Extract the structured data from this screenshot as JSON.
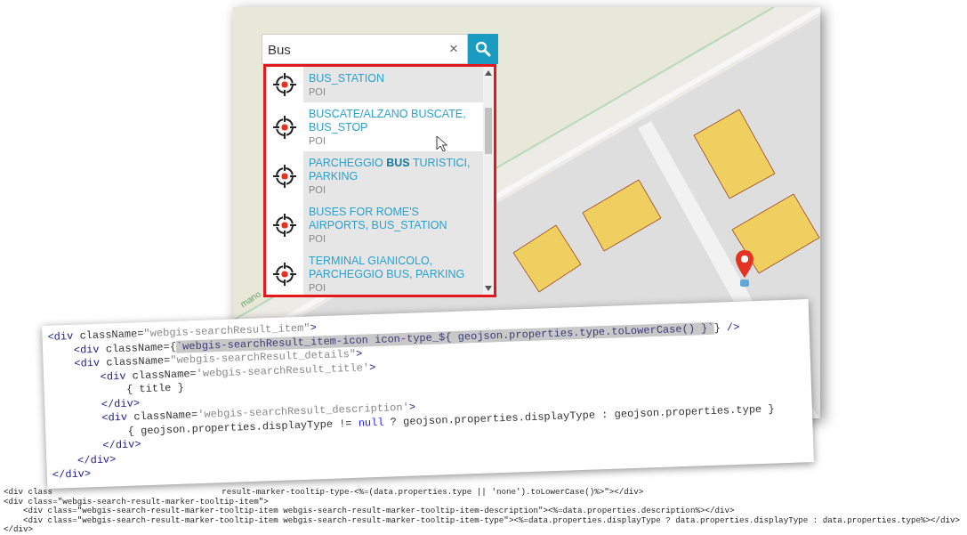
{
  "map": {
    "street_label": "mano"
  },
  "search": {
    "value": "Bus",
    "clear_label": "×"
  },
  "results": [
    {
      "title": "BUS_STATION",
      "type": "POI",
      "hovered": false
    },
    {
      "title": "BUSCATE/ALZANO BUSCATE, BUS_STOP",
      "type": "POI",
      "hovered": true
    },
    {
      "title": "PARCHEGGIO **BUS** TURISTICI, PARKING",
      "type": "POI",
      "hovered": false
    },
    {
      "title": "BUSES FOR ROME'S AIRPORTS, BUS_STATION",
      "type": "POI",
      "hovered": false
    },
    {
      "title": "TERMINAL GIANICOLO, PARCHEGGIO BUS, PARKING",
      "type": "POI",
      "hovered": false
    }
  ],
  "code_snippet": [
    [
      {
        "kind": "tag",
        "text": "<div "
      },
      {
        "kind": "attr",
        "text": "className="
      },
      {
        "kind": "string",
        "text": "\"webgis-searchResult_item\""
      },
      {
        "kind": "tag",
        "text": ">"
      }
    ],
    [
      {
        "kind": "tag",
        "text": "    <div "
      },
      {
        "kind": "attr",
        "text": "className={"
      },
      {
        "kind": "mark",
        "text": "`webgis-searchResult_item-icon icon-type_${ geojson.properties.type.toLowerCase() }`"
      },
      {
        "kind": "attr",
        "text": "}"
      },
      {
        "kind": "tag",
        "text": " />"
      }
    ],
    [
      {
        "kind": "tag",
        "text": "    <div "
      },
      {
        "kind": "attr",
        "text": "className="
      },
      {
        "kind": "string",
        "text": "\"webgis-searchResult_details\""
      },
      {
        "kind": "tag",
        "text": ">"
      }
    ],
    [
      {
        "kind": "tag",
        "text": "        <div "
      },
      {
        "kind": "attr",
        "text": "className="
      },
      {
        "kind": "string",
        "text": "'webgis-searchResult_title'"
      },
      {
        "kind": "tag",
        "text": ">"
      }
    ],
    [
      {
        "kind": "code",
        "text": "            { title }"
      }
    ],
    [
      {
        "kind": "tag",
        "text": "        </div>"
      }
    ],
    [
      {
        "kind": "tag",
        "text": "        <div "
      },
      {
        "kind": "attr",
        "text": "className="
      },
      {
        "kind": "string",
        "text": "'webgis-searchResult_description'"
      },
      {
        "kind": "tag",
        "text": ">"
      }
    ],
    [
      {
        "kind": "code",
        "text": "            { geojson.properties.displayType != "
      },
      {
        "kind": "keyword",
        "text": "null"
      },
      {
        "kind": "code",
        "text": " ? geojson.properties.displayType : geojson.properties.type }"
      }
    ],
    [
      {
        "kind": "tag",
        "text": "        </div>"
      }
    ],
    [
      {
        "kind": "tag",
        "text": "    </div>"
      }
    ],
    [
      {
        "kind": "tag",
        "text": "</div>"
      }
    ]
  ],
  "template_code": [
    [
      "<div class",
      "result-marker-tooltip-type-<%=(data.properties.type || 'none').toLowerCase()%>\"></div>"
    ],
    [
      "<div class=\"webgis-search-result-marker-tooltip-item\">"
    ],
    [
      "    <div class=\"webgis-search-result-marker-tooltip-item webgis-search-result-marker-tooltip-item-description\"><%=data.properties.description%></div>"
    ],
    [
      "    <div class=\"webgis-search-result-marker-tooltip-item webgis-search-result-marker-tooltip-item-type\"><%=data.properties.displayType ? data.properties.displayType : data.properties.type%></div>"
    ],
    [
      "</div>"
    ]
  ]
}
